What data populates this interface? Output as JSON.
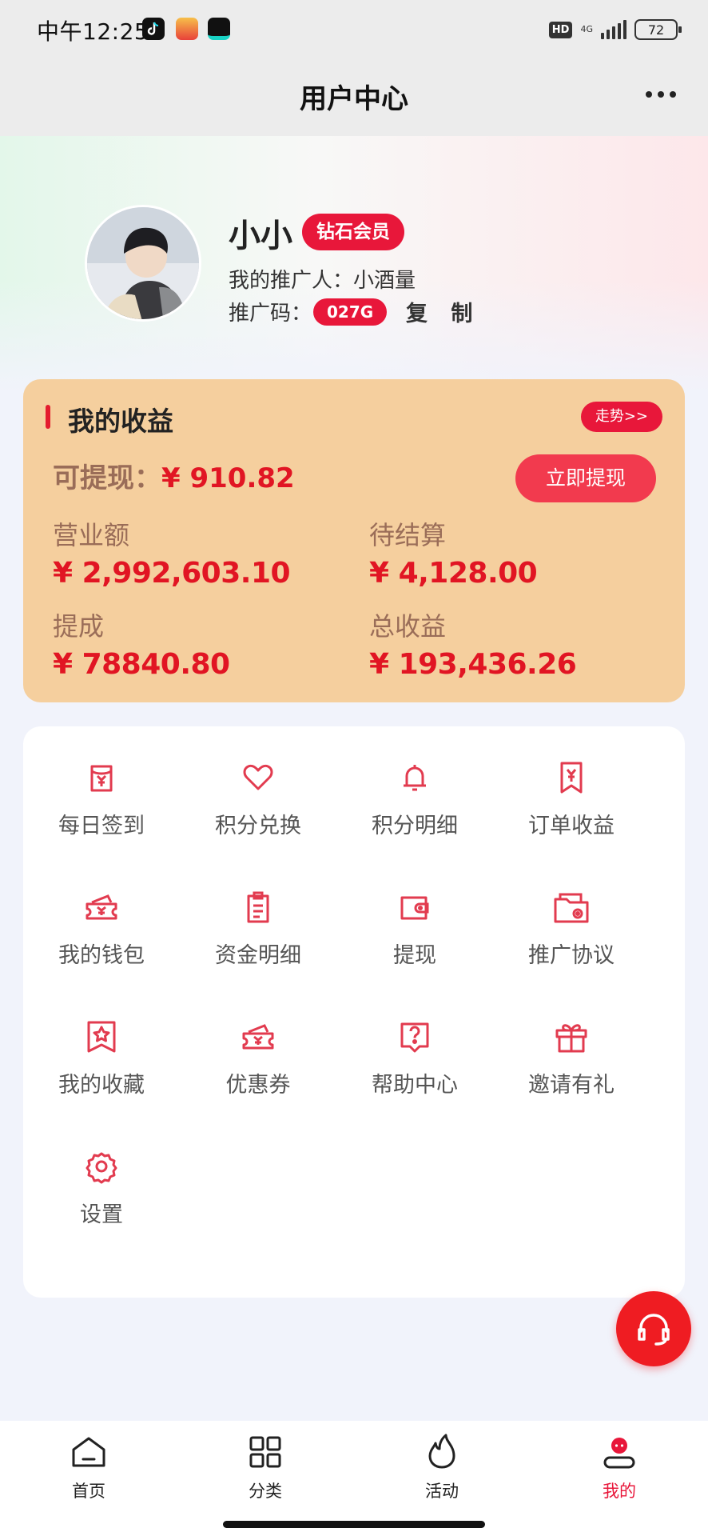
{
  "status_bar": {
    "time": "中午12:25",
    "hd": "HD",
    "network": "4G",
    "battery": "72"
  },
  "nav": {
    "title": "用户中心"
  },
  "profile": {
    "name": "小小",
    "badge": "钻石会员",
    "referrer_label": "我的推广人：",
    "referrer": "小酒量",
    "code_label": "推广码：",
    "code": "027G",
    "copy_label": "复 制"
  },
  "earnings": {
    "title": "我的收益",
    "trend_label": "走势>>",
    "available_label": "可提现：",
    "available_value": "¥ 910.82",
    "withdraw_label": "立即提现",
    "stats": [
      {
        "label": "营业额",
        "value": "¥ 2,992,603.10"
      },
      {
        "label": "待结算",
        "value": "¥ 4,128.00"
      },
      {
        "label": "提成",
        "value": "¥ 78840.80"
      },
      {
        "label": "总收益",
        "value": "¥ 193,436.26"
      }
    ]
  },
  "menu": [
    {
      "label": "每日签到",
      "icon": "checkin-icon"
    },
    {
      "label": "积分兑换",
      "icon": "heart-icon"
    },
    {
      "label": "积分明细",
      "icon": "bell-icon"
    },
    {
      "label": "订单收益",
      "icon": "yen-bookmark-icon"
    },
    {
      "label": "我的钱包",
      "icon": "yen-ticket-icon"
    },
    {
      "label": "资金明细",
      "icon": "clipboard-icon"
    },
    {
      "label": "提现",
      "icon": "wallet-icon"
    },
    {
      "label": "推广协议",
      "icon": "folder-icon"
    },
    {
      "label": "我的收藏",
      "icon": "star-bookmark-icon"
    },
    {
      "label": "优惠券",
      "icon": "coupon-icon"
    },
    {
      "label": "帮助中心",
      "icon": "help-icon"
    },
    {
      "label": "邀请有礼",
      "icon": "gift-icon"
    },
    {
      "label": "设置",
      "icon": "gear-icon"
    }
  ],
  "tabs": [
    {
      "label": "首页",
      "icon": "home-icon"
    },
    {
      "label": "分类",
      "icon": "grid-icon"
    },
    {
      "label": "活动",
      "icon": "flame-icon"
    },
    {
      "label": "我的",
      "icon": "user-icon",
      "active": true
    }
  ],
  "colors": {
    "accent": "#e8173a",
    "card": "#f5cf9e",
    "value_red": "#e11523"
  }
}
